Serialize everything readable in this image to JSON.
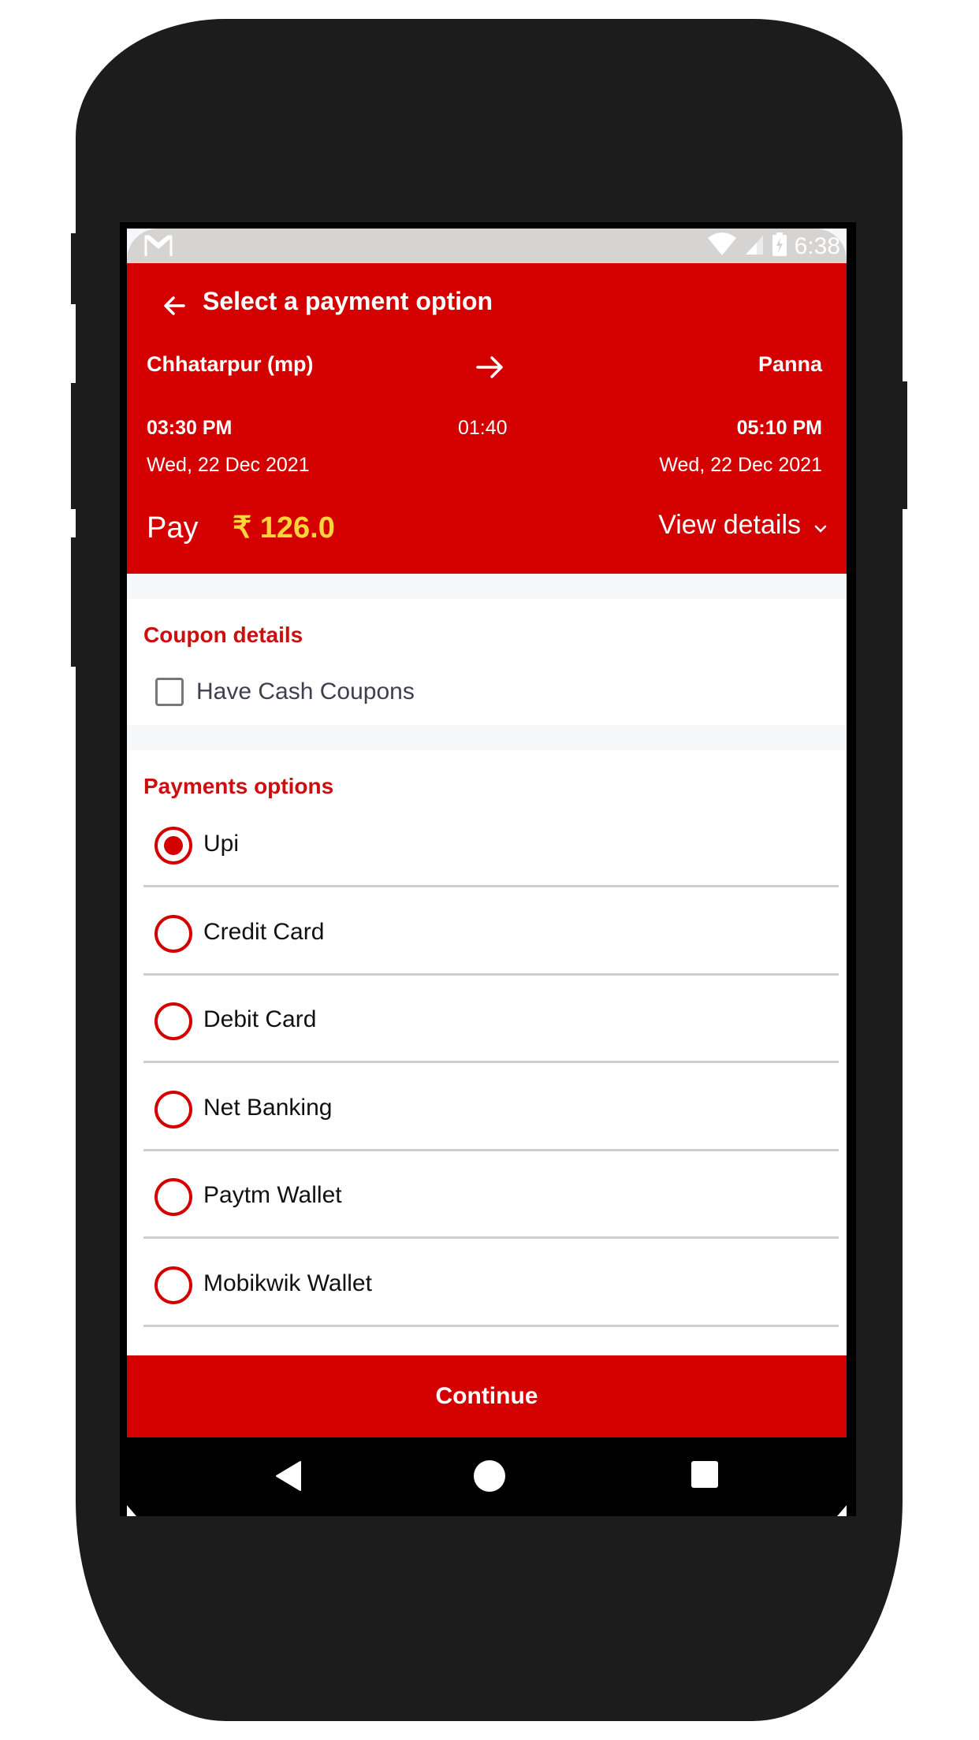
{
  "statusbar": {
    "notification_icon": "gmail-icon",
    "wifi_icon": "wifi-icon",
    "signal_icon": "cell-signal-icon",
    "battery_icon": "battery-charging-icon",
    "time": "6:38"
  },
  "header": {
    "back_icon": "arrow-left-icon",
    "title": "Select a payment option",
    "journey": {
      "from_city": "Chhatarpur (mp)",
      "to_city": "Panna",
      "route_icon": "arrow-right-icon",
      "departure_time": "03:30 PM",
      "arrival_time": "05:10 PM",
      "duration": "01:40",
      "departure_date": "Wed, 22 Dec 2021",
      "arrival_date": "Wed, 22 Dec 2021"
    },
    "pay_label": "Pay",
    "pay_amount": "₹ 126.0",
    "view_details_label": "View details",
    "view_details_icon": "chevron-down-icon"
  },
  "coupon": {
    "title": "Coupon details",
    "checkbox_label": "Have Cash Coupons",
    "checked": false
  },
  "payments": {
    "title": "Payments options",
    "selected": "Upi",
    "options": [
      {
        "label": "Upi",
        "selected": true
      },
      {
        "label": "Credit Card",
        "selected": false
      },
      {
        "label": "Debit Card",
        "selected": false
      },
      {
        "label": "Net Banking",
        "selected": false
      },
      {
        "label": "Paytm Wallet",
        "selected": false
      },
      {
        "label": "Mobikwik Wallet",
        "selected": false
      }
    ]
  },
  "continue_label": "Continue",
  "navbar": {
    "back": "nav-back-icon",
    "home": "nav-home-icon",
    "recents": "nav-recents-icon"
  },
  "colors": {
    "brand_red": "#d40000",
    "section_title_red": "#cc0e0e",
    "amount_yellow": "#ffd33b",
    "statusbar_grey": "#d6d4d2",
    "phone_body": "#1c1c1c"
  }
}
